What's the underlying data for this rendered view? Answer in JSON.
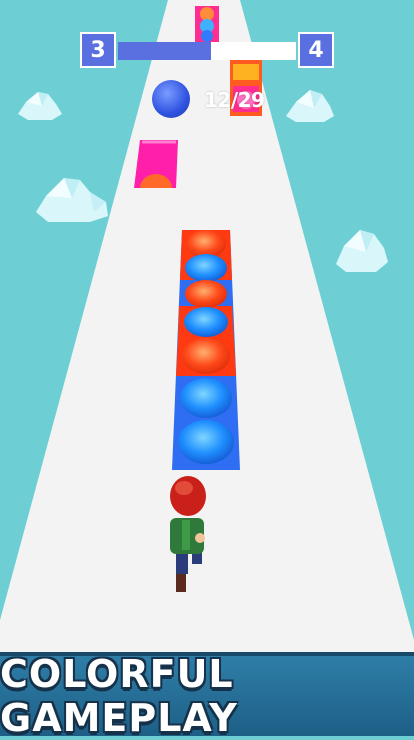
{
  "hud": {
    "current_level": "3",
    "next_level": "4",
    "progress": 0.52,
    "ball_count": "12/29",
    "ball_icon": "blue-ball-icon"
  },
  "banner": {
    "text": "COLORFUL GAMEPLAY"
  },
  "colors": {
    "sky": "#6dcfd3",
    "road": "#f2f2f2",
    "accent": "#5a6fe0",
    "bubble_blue": "#1f8fff",
    "bubble_orange": "#ff4a1a",
    "bubble_magenta": "#ff1fa8",
    "banner": "#2f7ea8"
  }
}
